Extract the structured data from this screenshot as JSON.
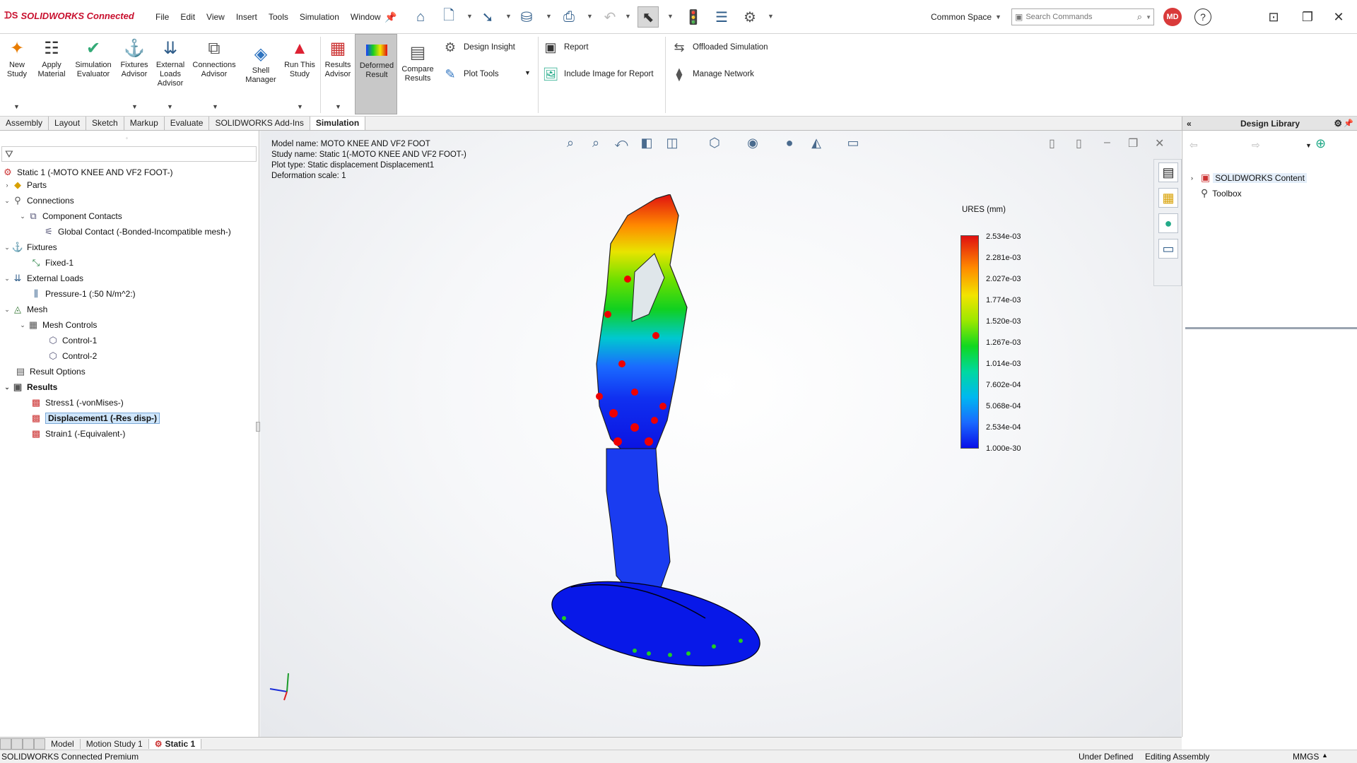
{
  "app": {
    "name": "SOLIDWORKS Connected"
  },
  "menu": [
    "File",
    "Edit",
    "View",
    "Insert",
    "Tools",
    "Simulation",
    "Window"
  ],
  "titlebar": {
    "common_space": "Common Space",
    "search_placeholder": "Search Commands",
    "avatar": "MD"
  },
  "ribbon": {
    "new_study": "New Study",
    "apply_material": "Apply Material",
    "simulation_evaluator": "Simulation Evaluator",
    "fixtures_advisor": "Fixtures Advisor",
    "external_loads_advisor": "External Loads Advisor",
    "connections_advisor": "Connections Advisor",
    "shell_manager": "Shell Manager",
    "run_this_study": "Run This Study",
    "results_advisor": "Results Advisor",
    "deformed_result": "Deformed Result",
    "compare_results": "Compare Results",
    "design_insight": "Design Insight",
    "plot_tools": "Plot Tools",
    "report": "Report",
    "include_image": "Include Image for Report",
    "offloaded_simulation": "Offloaded Simulation",
    "manage_network": "Manage Network"
  },
  "command_tabs": [
    "Assembly",
    "Layout",
    "Sketch",
    "Markup",
    "Evaluate",
    "SOLIDWORKS Add-Ins",
    "Simulation"
  ],
  "tree": {
    "root": "Static 1 (-MOTO KNEE AND VF2 FOOT-)",
    "parts": "Parts",
    "connections": "Connections",
    "component_contacts": "Component Contacts",
    "global_contact": "Global Contact (-Bonded-Incompatible mesh-)",
    "fixtures": "Fixtures",
    "fixed1": "Fixed-1",
    "external_loads": "External Loads",
    "pressure1": "Pressure-1 (:50 N/m^2:)",
    "mesh": "Mesh",
    "mesh_controls": "Mesh Controls",
    "control1": "Control-1",
    "control2": "Control-2",
    "result_options": "Result Options",
    "results": "Results",
    "stress1": "Stress1 (-vonMises-)",
    "displacement1": "Displacement1 (-Res disp-)",
    "strain1": "Strain1 (-Equivalent-)"
  },
  "viewport_info": {
    "model_name": "Model name: MOTO KNEE AND VF2 FOOT",
    "study_name": "Study name: Static 1(-MOTO KNEE AND VF2 FOOT-)",
    "plot_type": "Plot type: Static displacement Displacement1",
    "deformation_scale": "Deformation scale: 1"
  },
  "legend": {
    "title": "URES (mm)",
    "labels": [
      "2.534e-03",
      "2.281e-03",
      "2.027e-03",
      "1.774e-03",
      "1.520e-03",
      "1.267e-03",
      "1.014e-03",
      "7.602e-04",
      "5.068e-04",
      "2.534e-04",
      "1.000e-30"
    ]
  },
  "right_panel": {
    "title": "Design Library",
    "item1": "SOLIDWORKS Content",
    "item2": "Toolbox"
  },
  "bottom_tabs": [
    "Model",
    "Motion Study 1",
    "Static 1"
  ],
  "status": {
    "left": "SOLIDWORKS Connected Premium",
    "under_defined": "Under Defined",
    "editing": "Editing Assembly",
    "units": "MMGS"
  }
}
